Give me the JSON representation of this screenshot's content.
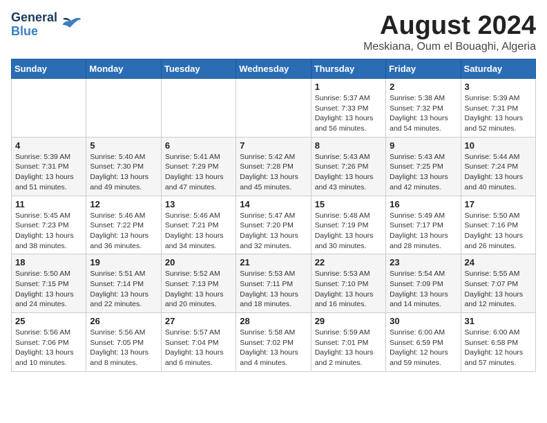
{
  "header": {
    "logo_line1": "General",
    "logo_line2": "Blue",
    "month_title": "August 2024",
    "subtitle": "Meskiana, Oum el Bouaghi, Algeria"
  },
  "days_of_week": [
    "Sunday",
    "Monday",
    "Tuesday",
    "Wednesday",
    "Thursday",
    "Friday",
    "Saturday"
  ],
  "weeks": [
    [
      {
        "num": "",
        "info": ""
      },
      {
        "num": "",
        "info": ""
      },
      {
        "num": "",
        "info": ""
      },
      {
        "num": "",
        "info": ""
      },
      {
        "num": "1",
        "info": "Sunrise: 5:37 AM\nSunset: 7:33 PM\nDaylight: 13 hours and 56 minutes."
      },
      {
        "num": "2",
        "info": "Sunrise: 5:38 AM\nSunset: 7:32 PM\nDaylight: 13 hours and 54 minutes."
      },
      {
        "num": "3",
        "info": "Sunrise: 5:39 AM\nSunset: 7:31 PM\nDaylight: 13 hours and 52 minutes."
      }
    ],
    [
      {
        "num": "4",
        "info": "Sunrise: 5:39 AM\nSunset: 7:31 PM\nDaylight: 13 hours and 51 minutes."
      },
      {
        "num": "5",
        "info": "Sunrise: 5:40 AM\nSunset: 7:30 PM\nDaylight: 13 hours and 49 minutes."
      },
      {
        "num": "6",
        "info": "Sunrise: 5:41 AM\nSunset: 7:29 PM\nDaylight: 13 hours and 47 minutes."
      },
      {
        "num": "7",
        "info": "Sunrise: 5:42 AM\nSunset: 7:28 PM\nDaylight: 13 hours and 45 minutes."
      },
      {
        "num": "8",
        "info": "Sunrise: 5:43 AM\nSunset: 7:26 PM\nDaylight: 13 hours and 43 minutes."
      },
      {
        "num": "9",
        "info": "Sunrise: 5:43 AM\nSunset: 7:25 PM\nDaylight: 13 hours and 42 minutes."
      },
      {
        "num": "10",
        "info": "Sunrise: 5:44 AM\nSunset: 7:24 PM\nDaylight: 13 hours and 40 minutes."
      }
    ],
    [
      {
        "num": "11",
        "info": "Sunrise: 5:45 AM\nSunset: 7:23 PM\nDaylight: 13 hours and 38 minutes."
      },
      {
        "num": "12",
        "info": "Sunrise: 5:46 AM\nSunset: 7:22 PM\nDaylight: 13 hours and 36 minutes."
      },
      {
        "num": "13",
        "info": "Sunrise: 5:46 AM\nSunset: 7:21 PM\nDaylight: 13 hours and 34 minutes."
      },
      {
        "num": "14",
        "info": "Sunrise: 5:47 AM\nSunset: 7:20 PM\nDaylight: 13 hours and 32 minutes."
      },
      {
        "num": "15",
        "info": "Sunrise: 5:48 AM\nSunset: 7:19 PM\nDaylight: 13 hours and 30 minutes."
      },
      {
        "num": "16",
        "info": "Sunrise: 5:49 AM\nSunset: 7:17 PM\nDaylight: 13 hours and 28 minutes."
      },
      {
        "num": "17",
        "info": "Sunrise: 5:50 AM\nSunset: 7:16 PM\nDaylight: 13 hours and 26 minutes."
      }
    ],
    [
      {
        "num": "18",
        "info": "Sunrise: 5:50 AM\nSunset: 7:15 PM\nDaylight: 13 hours and 24 minutes."
      },
      {
        "num": "19",
        "info": "Sunrise: 5:51 AM\nSunset: 7:14 PM\nDaylight: 13 hours and 22 minutes."
      },
      {
        "num": "20",
        "info": "Sunrise: 5:52 AM\nSunset: 7:13 PM\nDaylight: 13 hours and 20 minutes."
      },
      {
        "num": "21",
        "info": "Sunrise: 5:53 AM\nSunset: 7:11 PM\nDaylight: 13 hours and 18 minutes."
      },
      {
        "num": "22",
        "info": "Sunrise: 5:53 AM\nSunset: 7:10 PM\nDaylight: 13 hours and 16 minutes."
      },
      {
        "num": "23",
        "info": "Sunrise: 5:54 AM\nSunset: 7:09 PM\nDaylight: 13 hours and 14 minutes."
      },
      {
        "num": "24",
        "info": "Sunrise: 5:55 AM\nSunset: 7:07 PM\nDaylight: 13 hours and 12 minutes."
      }
    ],
    [
      {
        "num": "25",
        "info": "Sunrise: 5:56 AM\nSunset: 7:06 PM\nDaylight: 13 hours and 10 minutes."
      },
      {
        "num": "26",
        "info": "Sunrise: 5:56 AM\nSunset: 7:05 PM\nDaylight: 13 hours and 8 minutes."
      },
      {
        "num": "27",
        "info": "Sunrise: 5:57 AM\nSunset: 7:04 PM\nDaylight: 13 hours and 6 minutes."
      },
      {
        "num": "28",
        "info": "Sunrise: 5:58 AM\nSunset: 7:02 PM\nDaylight: 13 hours and 4 minutes."
      },
      {
        "num": "29",
        "info": "Sunrise: 5:59 AM\nSunset: 7:01 PM\nDaylight: 13 hours and 2 minutes."
      },
      {
        "num": "30",
        "info": "Sunrise: 6:00 AM\nSunset: 6:59 PM\nDaylight: 12 hours and 59 minutes."
      },
      {
        "num": "31",
        "info": "Sunrise: 6:00 AM\nSunset: 6:58 PM\nDaylight: 12 hours and 57 minutes."
      }
    ]
  ]
}
